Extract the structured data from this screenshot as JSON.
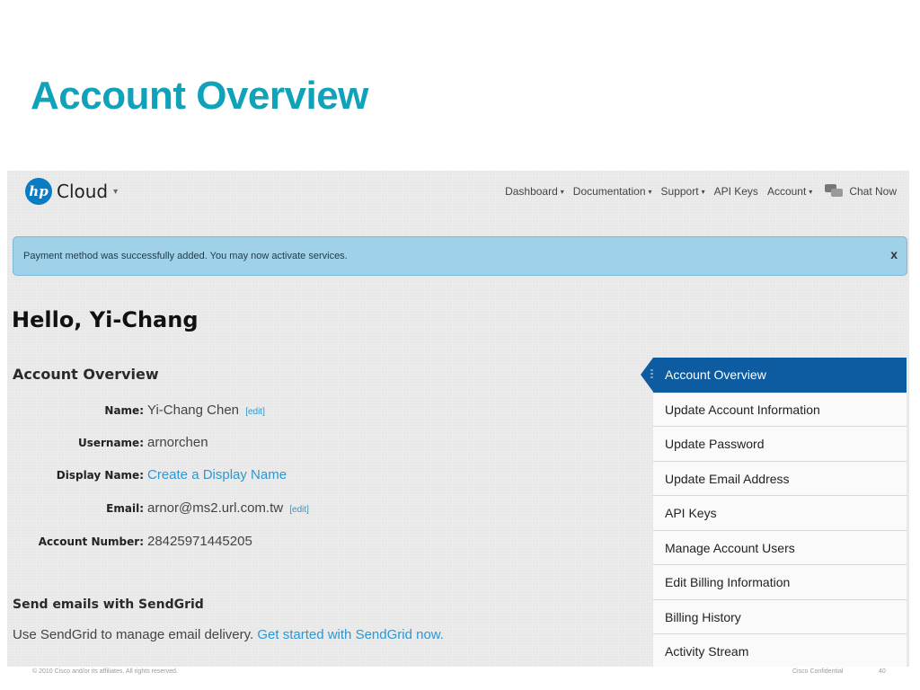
{
  "slide": {
    "title": "Account Overview",
    "footer_left": "© 2010 Cisco and/or its affiliates. All rights reserved.",
    "footer_right": "Cisco Confidential",
    "page_number": "40"
  },
  "app": {
    "logo_mark": "hp",
    "logo_text": "Cloud",
    "logo_caret": "▾",
    "nav": [
      {
        "label": "Dashboard",
        "has_caret": true
      },
      {
        "label": "Documentation",
        "has_caret": true
      },
      {
        "label": "Support",
        "has_caret": true
      },
      {
        "label": "API Keys",
        "has_caret": false
      },
      {
        "label": "Account",
        "has_caret": true
      }
    ],
    "chat_label": "Chat Now",
    "caret_glyph": "▾",
    "alert": {
      "message": "Payment method was successfully added. You may now activate services.",
      "close": "x"
    },
    "greeting": "Hello, Yi-Chang",
    "section_title": "Account Overview",
    "fields": [
      {
        "label": "Name:",
        "value": "Yi-Chang Chen",
        "edit": "[edit]"
      },
      {
        "label": "Username:",
        "value": "arnorchen",
        "edit": ""
      },
      {
        "label": "Display Name:",
        "value": "Create a Display Name",
        "edit": ""
      },
      {
        "label": "Email:",
        "value": "arnor@ms2.url.com.tw",
        "edit": "[edit]"
      },
      {
        "label": "Account Number:",
        "value": "28425971445205",
        "edit": ""
      }
    ],
    "sendgrid": {
      "title": "Send emails with SendGrid",
      "text": "Use SendGrid to manage email delivery.",
      "link": "Get started with SendGrid now."
    },
    "menu": [
      "Account Overview",
      "Update Account Information",
      "Update Password",
      "Update Email Address",
      "API Keys",
      "Manage Account Users",
      "Edit Billing Information",
      "Billing History",
      "Activity Stream"
    ],
    "colors": {
      "title": "#10a2b8",
      "link": "#2d97d1",
      "active_menu": "#0d5ba0",
      "alert_bg": "#9fd1e9"
    }
  }
}
